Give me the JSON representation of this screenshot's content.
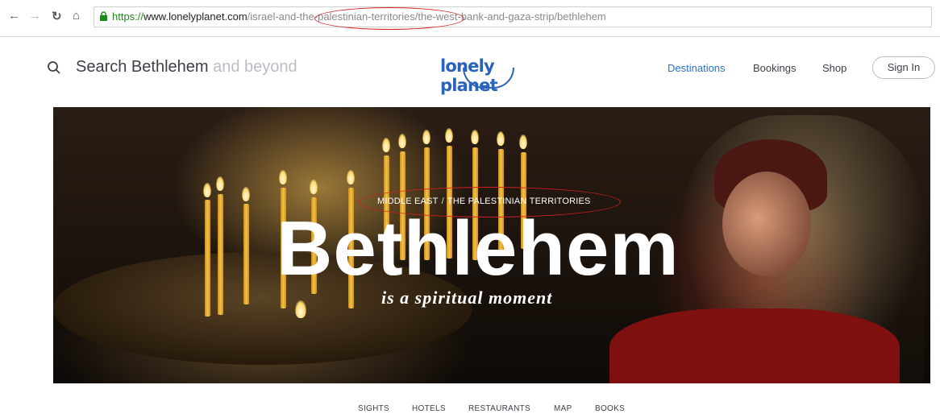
{
  "browser": {
    "url": {
      "scheme": "https://",
      "host": "www.lonelyplanet.com",
      "path": "/israel-and-the-palestinian-territories/the-west-bank-and-gaza-strip/bethlehem"
    },
    "icons": [
      "back-arrow-icon",
      "forward-arrow-icon",
      "reload-icon",
      "home-icon",
      "lock-icon"
    ]
  },
  "header": {
    "search_label": "Search Bethlehem",
    "search_placeholder": "and beyond",
    "logo_text": "lonely planet",
    "nav": [
      "Destinations",
      "Bookings",
      "Shop"
    ],
    "signin_label": "Sign In"
  },
  "hero": {
    "breadcrumb": [
      "MIDDLE EAST",
      "THE PALESTINIAN TERRITORIES"
    ],
    "breadcrumb_separator": "/",
    "title": "Bethlehem",
    "tagline": "is a spiritual moment"
  },
  "subnav": [
    "SIGHTS",
    "HOTELS",
    "RESTAURANTS",
    "MAP",
    "BOOKS"
  ],
  "colors": {
    "brand_blue": "#2b63b8",
    "active_nav": "#2a74c9",
    "annotation_red": "#d21f1f"
  }
}
